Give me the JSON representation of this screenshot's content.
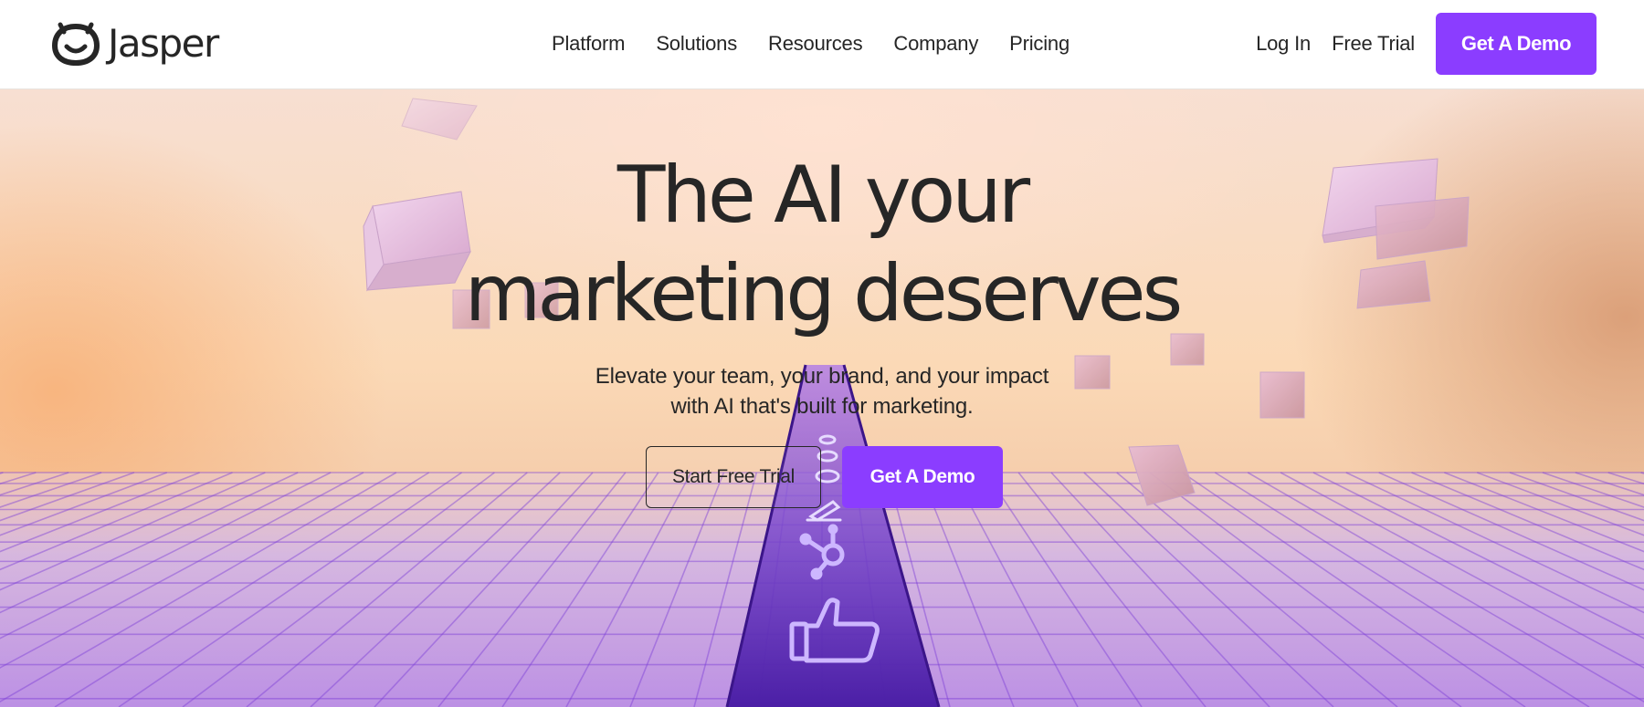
{
  "brand": {
    "name": "Jasper",
    "logo_icon": "jasper-face-logo-icon",
    "accent_color": "#8b3dff",
    "text_color": "#262626"
  },
  "nav": {
    "items": [
      {
        "label": "Platform"
      },
      {
        "label": "Solutions"
      },
      {
        "label": "Resources"
      },
      {
        "label": "Company"
      },
      {
        "label": "Pricing"
      }
    ]
  },
  "header_actions": {
    "login_label": "Log In",
    "free_trial_label": "Free Trial",
    "demo_label": "Get A Demo"
  },
  "hero": {
    "title_line1": "The AI your",
    "title_line2": "marketing deserves",
    "subtitle_line1": "Elevate your team, your brand, and your impact",
    "subtitle_line2": "with AI that's built for marketing.",
    "primary_cta": "Start Free Trial",
    "secondary_cta": "Get A Demo",
    "path_icons": [
      "thumbs-up-icon",
      "hubspot-icon",
      "pen-icon",
      "integration-icon"
    ]
  }
}
